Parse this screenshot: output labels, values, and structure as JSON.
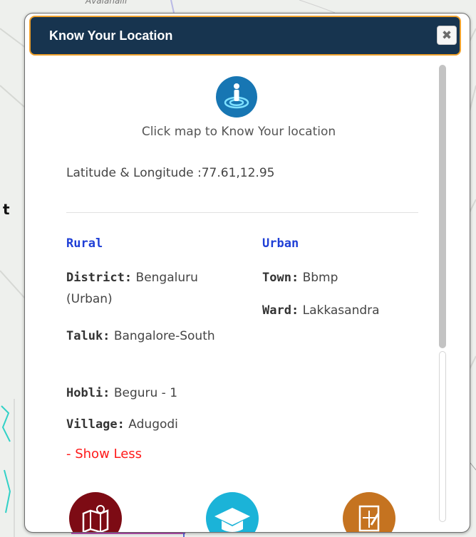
{
  "map": {
    "top_label": "Avalahalli",
    "left_letter": "t"
  },
  "panel": {
    "title": "Know Your Location",
    "close_label": "✖",
    "instruction": "Click map to Know Your location",
    "latlng_label": "Latitude & Longitude :",
    "latlng_value": "77.61,12.95"
  },
  "rural": {
    "heading": "Rural",
    "district_key": "District:",
    "district_value": " Bengaluru (Urban)",
    "taluk_key": "Taluk:",
    "taluk_value": " Bangalore-South",
    "hobli_key": "Hobli:",
    "hobli_value": " Beguru - 1",
    "village_key": "Village:",
    "village_value": " Adugodi"
  },
  "urban": {
    "heading": "Urban",
    "town_key": "Town:",
    "town_value": " Bbmp",
    "ward_key": "Ward:",
    "ward_value": " Lakkasandra"
  },
  "toggle": {
    "show_less": "- Show Less"
  },
  "icons": {
    "locate": "location-pin-icon",
    "bottom": [
      "map-icon",
      "graduation-cap-icon",
      "document-edit-icon"
    ]
  },
  "colors": {
    "header_bg": "#17344f",
    "header_border": "#f0a12b",
    "heading_blue": "#1f3fd6",
    "show_less_red": "#ff1a1a",
    "icon_maroon": "#7d0b14",
    "icon_cyan": "#1bb3d8",
    "icon_orange": "#c57320"
  }
}
